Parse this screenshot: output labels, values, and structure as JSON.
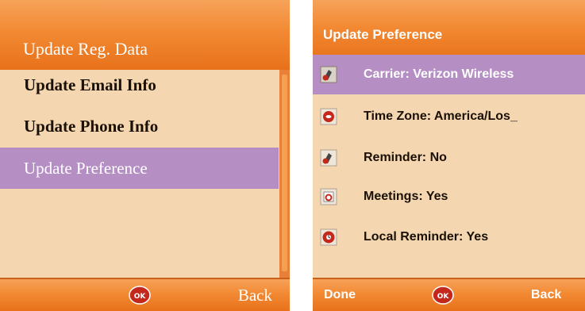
{
  "left_screen": {
    "title": "Update Reg. Data",
    "menu_items": [
      {
        "label": "Update Email Info",
        "selected": false
      },
      {
        "label": "Update Phone Info",
        "selected": false
      },
      {
        "label": "Update Preference",
        "selected": true
      }
    ],
    "soft_keys": {
      "center": "ok-icon",
      "right": "Back"
    }
  },
  "right_screen": {
    "title": "Update Preference",
    "items": [
      {
        "label": "Carrier: Verizon Wireless",
        "icon": "phone-icon",
        "selected": true
      },
      {
        "label": "Time Zone: America/Los_",
        "icon": "globe-icon",
        "selected": false
      },
      {
        "label": "Reminder:  No",
        "icon": "phone-icon",
        "selected": false
      },
      {
        "label": "Meetings: Yes",
        "icon": "calendar-icon",
        "selected": false
      },
      {
        "label": "Local Reminder: Yes",
        "icon": "alarm-icon",
        "selected": false
      }
    ],
    "soft_keys": {
      "left": "Done",
      "center": "ok-icon",
      "right": "Back"
    }
  },
  "colors": {
    "accent_orange": "#f28a33",
    "selection_purple": "#b58fc4",
    "background_peach": "#f4d7b1"
  }
}
